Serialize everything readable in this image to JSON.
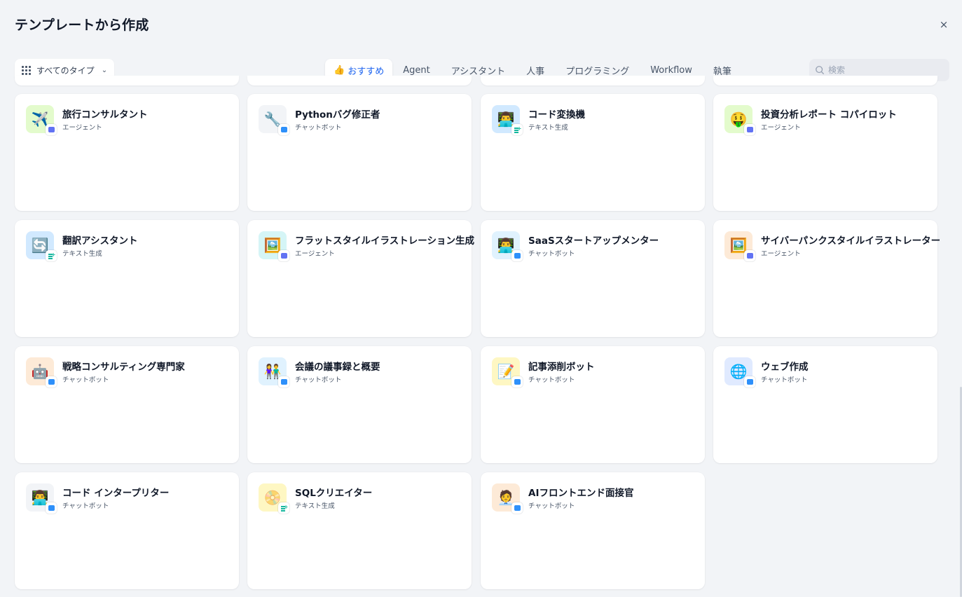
{
  "header": {
    "title": "テンプレートから作成",
    "close_icon": "×"
  },
  "filter": {
    "type_label": "すべてのタイプ"
  },
  "tabs": [
    {
      "label": "おすすめ",
      "active": true,
      "icon": "thumbs-up-icon"
    },
    {
      "label": "Agent"
    },
    {
      "label": "アシスタント"
    },
    {
      "label": "人事"
    },
    {
      "label": "プログラミング"
    },
    {
      "label": "Workflow"
    },
    {
      "label": "執筆"
    }
  ],
  "search": {
    "placeholder": "検索",
    "value": ""
  },
  "cards": [
    {
      "name": "旅行コンサルタント",
      "type": "エージェント",
      "emoji": "✈️",
      "icon_bg": "#e3fbcc",
      "badge": "agent"
    },
    {
      "name": "Pythonバグ修正者",
      "type": "チャットボット",
      "emoji": "🔧",
      "icon_bg": "#f2f4f7",
      "badge": "chat"
    },
    {
      "name": "コード変換機",
      "type": "テキスト生成",
      "emoji": "👨‍💻",
      "icon_bg": "#d1e9ff",
      "badge": "text"
    },
    {
      "name": "投資分析レポート コパイロット",
      "type": "エージェント",
      "emoji": "🤑",
      "icon_bg": "#e3fbcc",
      "badge": "agent"
    },
    {
      "name": "翻訳アシスタント",
      "type": "テキスト生成",
      "emoji": "🔄",
      "icon_bg": "#d1e9ff",
      "badge": "text"
    },
    {
      "name": "フラットスタイルイラストレーション生成",
      "type": "エージェント",
      "emoji": "🖼️",
      "icon_bg": "#d5f5f6",
      "badge": "agent"
    },
    {
      "name": "SaaSスタートアップメンター",
      "type": "チャットボット",
      "emoji": "👨‍💻",
      "icon_bg": "#e0f2fe",
      "badge": "chat"
    },
    {
      "name": "サイバーパンクスタイルイラストレーター",
      "type": "エージェント",
      "emoji": "🖼️",
      "icon_bg": "#fdead7",
      "badge": "agent"
    },
    {
      "name": "戦略コンサルティング専門家",
      "type": "チャットボット",
      "emoji": "🤖",
      "icon_bg": "#fdead7",
      "badge": "chat"
    },
    {
      "name": "会議の議事録と概要",
      "type": "チャットボット",
      "emoji": "👫",
      "icon_bg": "#e0f2fe",
      "badge": "chat"
    },
    {
      "name": "記事添削ボット",
      "type": "チャットボット",
      "emoji": "📝",
      "icon_bg": "#fef7c3",
      "badge": "chat"
    },
    {
      "name": "ウェブ作成",
      "type": "チャットボット",
      "emoji": "🌐",
      "icon_bg": "#e0eaff",
      "badge": "chat"
    },
    {
      "name": "コード インタープリター",
      "type": "チャットボット",
      "emoji": "👨‍💻",
      "icon_bg": "#f2f4f7",
      "badge": "chat"
    },
    {
      "name": "SQLクリエイター",
      "type": "テキスト生成",
      "emoji": "📀",
      "icon_bg": "#fef7c3",
      "badge": "text"
    },
    {
      "name": "AIフロントエンド面接官",
      "type": "チャットボット",
      "emoji": "🧑‍💼",
      "icon_bg": "#fdead7",
      "badge": "chat"
    }
  ]
}
